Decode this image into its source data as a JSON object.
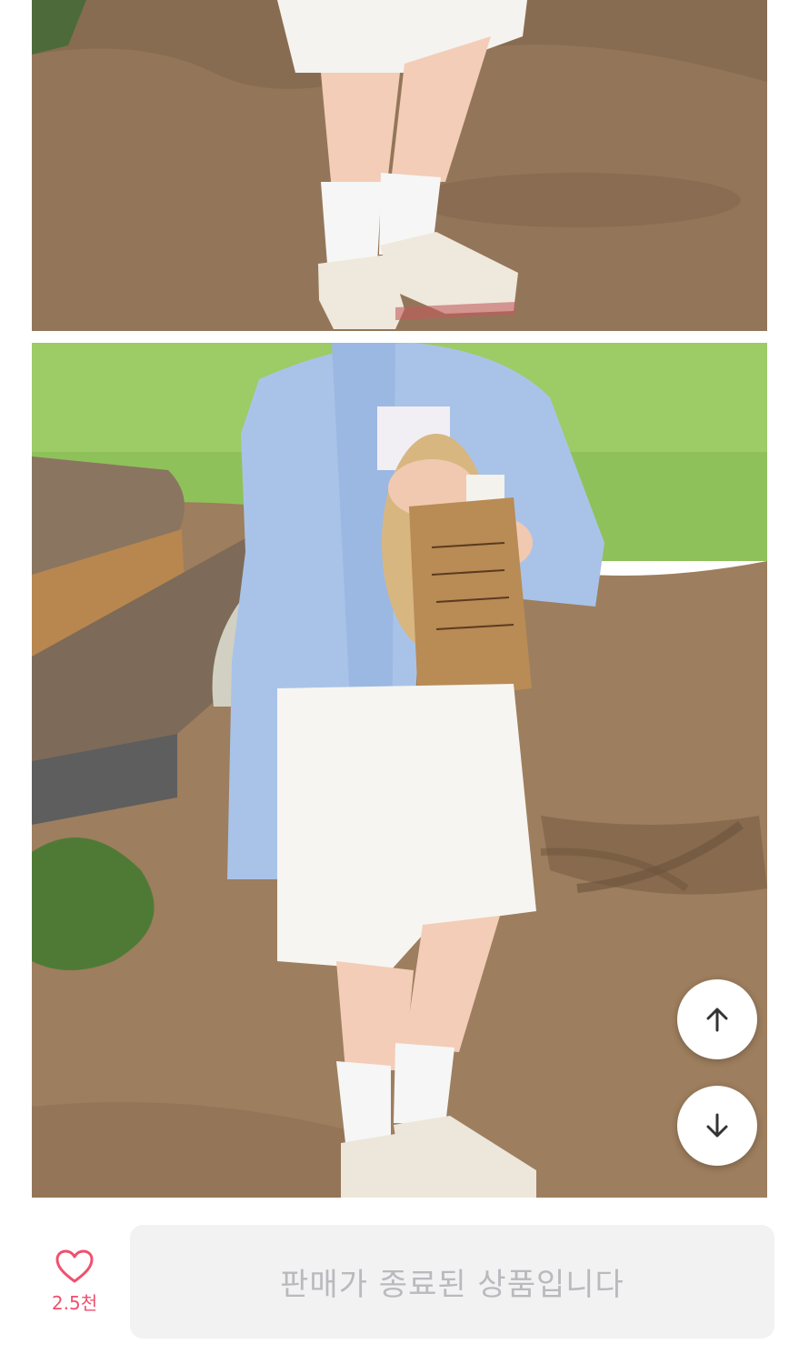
{
  "product": {
    "photos": [
      {
        "icon": "photo-legs-white-shorts-sneakers-on-dirt"
      },
      {
        "icon": "photo-blue-striped-shirt-white-shorts-park-bench"
      }
    ]
  },
  "navigation": {
    "scroll_up_icon": "arrow-up-icon",
    "scroll_down_icon": "arrow-down-icon"
  },
  "action_bar": {
    "like_icon": "heart-outline-icon",
    "like_count": "2.5천",
    "status_label": "판매가 종료된 상품입니다"
  },
  "colors": {
    "like_accent": "#f0506e",
    "disabled_button_bg": "#f2f2f3",
    "disabled_text": "#b9b9be"
  }
}
